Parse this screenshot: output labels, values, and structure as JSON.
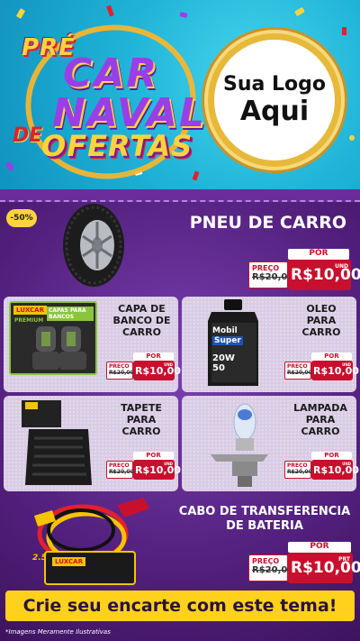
{
  "header": {
    "title_pre": "PRÉ",
    "title_car": "CAR",
    "title_naval": "NAVAL",
    "title_de": "DE",
    "title_ofertas": "OFERTAS",
    "logo_line1": "Sua Logo",
    "logo_line2": "Aqui"
  },
  "products": [
    {
      "name": "PNEU DE CARRO",
      "discount": "-50%",
      "price_label": "PREÇO",
      "old_price": "R$20,00",
      "por_label": "POR",
      "new_price": "R$10,00",
      "unit": "UND"
    },
    {
      "name": "CAPA DE BANCO DE CARRO",
      "price_label": "PREÇO",
      "old_price": "R$20,00",
      "por_label": "POR",
      "new_price": "R$10,00",
      "unit": "UND",
      "package_brand": "LUXCAR",
      "package_text": "CAPAS PARA BANCOS",
      "package_sub": "PREMIUM"
    },
    {
      "name": "OLEO PARA CARRO",
      "price_label": "PREÇO",
      "old_price": "R$20,00",
      "por_label": "POR",
      "new_price": "R$10,00",
      "unit": "UND",
      "bottle_brand": "Mobil",
      "bottle_sub": "Super",
      "bottle_spec": "20W 50"
    },
    {
      "name": "TAPETE PARA CARRO",
      "price_label": "PREÇO",
      "old_price": "R$20,00",
      "por_label": "POR",
      "new_price": "R$10,00",
      "unit": "UND"
    },
    {
      "name": "LAMPADA PARA CARRO",
      "price_label": "PREÇO",
      "old_price": "R$20,00",
      "por_label": "POR",
      "new_price": "R$10,00",
      "unit": "UND"
    },
    {
      "name": "CABO DE TRANSFERENCIA DE BATERIA",
      "price_label": "PREÇO",
      "old_price": "R$20,00",
      "por_label": "POR",
      "new_price": "R$10,00",
      "unit": "PRT",
      "package_brand": "LUXCAR",
      "package_size": "2.5"
    }
  ],
  "cta": "Crie seu encarte com este tema!",
  "disclaimer": "*Imagens Meramente Ilustrativas",
  "colors": {
    "header_bg": "#20b4d8",
    "body_bg": "#53207e",
    "price_red": "#c8102e",
    "cta_yellow": "#ffd11c",
    "card_bg": "#d9cce4"
  }
}
